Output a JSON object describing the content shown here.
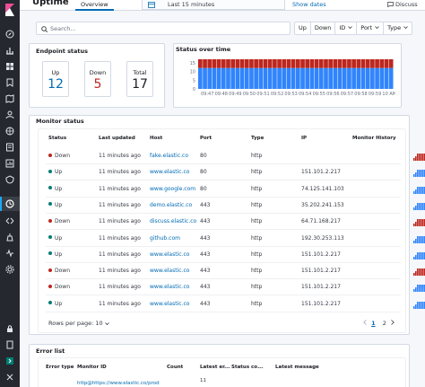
{
  "header": {
    "title": "Uptime",
    "tab": "Overview",
    "date_range": "Last 15 minutes",
    "show_dates": "Show dates",
    "discuss": "Discuss"
  },
  "search": {
    "placeholder": "Search..."
  },
  "filters": [
    "Up",
    "Down",
    "ID",
    "Port",
    "Type"
  ],
  "endpoint_status": {
    "title": "Endpoint status",
    "up_label": "Up",
    "up": "12",
    "down_label": "Down",
    "down": "5",
    "total_label": "Total",
    "total": "17"
  },
  "status_over_time": {
    "title": "Status over time",
    "y_ticks": [
      "15",
      "10",
      "5",
      "0"
    ],
    "x_ticks": [
      "09:47",
      "09:48",
      "09:49",
      "09:50",
      "09:51",
      "09:52",
      "09:53",
      "09:54",
      "09:55",
      "09:56",
      "09:57",
      "09:58",
      "09:59",
      "10 AM"
    ]
  },
  "chart_data": {
    "type": "bar",
    "title": "Status over time",
    "ylim": [
      0,
      17
    ],
    "y_ticks": [
      15,
      10,
      5,
      0
    ],
    "x_ticks": [
      "09:47",
      "09:48",
      "09:49",
      "09:50",
      "09:51",
      "09:52",
      "09:53",
      "09:54",
      "09:55",
      "09:56",
      "09:57",
      "09:58",
      "09:59",
      "10 AM"
    ],
    "stacked": true,
    "series": [
      {
        "values": [
          12,
          12,
          12,
          12,
          12,
          12,
          12,
          12,
          12,
          12,
          12,
          12,
          12,
          12,
          12,
          12,
          12,
          12,
          12,
          12,
          12,
          12,
          12,
          12,
          12,
          12,
          12,
          12,
          12,
          12,
          12,
          12,
          12,
          12,
          12,
          12,
          12,
          12,
          12,
          12,
          12,
          12
        ]
      },
      {
        "values": [
          5,
          5,
          5,
          5,
          5,
          5,
          5,
          5,
          5,
          5,
          5,
          5,
          5,
          5,
          5,
          5,
          5,
          5,
          5,
          5,
          5,
          5,
          5,
          5,
          5,
          5,
          5,
          5,
          5,
          5,
          5,
          5,
          5,
          5,
          5,
          5,
          5,
          5,
          5,
          5,
          5,
          5
        ]
      }
    ],
    "colors": {
      "up": "#3185fc",
      "down": "#bd271e"
    }
  },
  "monitor_status": {
    "title": "Monitor status",
    "columns": [
      "Status",
      "Last updated",
      "Host",
      "Port",
      "Type",
      "IP",
      "Monitor History"
    ],
    "rows": [
      {
        "status": "Down",
        "updated": "11 minutes ago",
        "host": "fake.elastic.co",
        "port": "80",
        "type": "http",
        "ip": "",
        "history": "down"
      },
      {
        "status": "Up",
        "updated": "11 minutes ago",
        "host": "www.elastic.co",
        "port": "80",
        "type": "http",
        "ip": "151.101.2.217",
        "history": "up"
      },
      {
        "status": "Up",
        "updated": "11 minutes ago",
        "host": "www.google.com",
        "port": "80",
        "type": "http",
        "ip": "74.125.141.103",
        "history": "up"
      },
      {
        "status": "Up",
        "updated": "11 minutes ago",
        "host": "demo.elastic.co",
        "port": "443",
        "type": "http",
        "ip": "35.202.241.153",
        "history": "up"
      },
      {
        "status": "Down",
        "updated": "11 minutes ago",
        "host": "discuss.elastic.co",
        "port": "443",
        "type": "http",
        "ip": "64.71.168.217",
        "history": "down"
      },
      {
        "status": "Up",
        "updated": "11 minutes ago",
        "host": "github.com",
        "port": "443",
        "type": "http",
        "ip": "192.30.253.113",
        "history": "up"
      },
      {
        "status": "Up",
        "updated": "11 minutes ago",
        "host": "www.elastic.co",
        "port": "443",
        "type": "http",
        "ip": "151.101.2.217",
        "history": "up"
      },
      {
        "status": "Down",
        "updated": "11 minutes ago",
        "host": "www.elastic.co",
        "port": "443",
        "type": "http",
        "ip": "151.101.2.217",
        "history": "down"
      },
      {
        "status": "Down",
        "updated": "11 minutes ago",
        "host": "www.elastic.co",
        "port": "443",
        "type": "http",
        "ip": "151.101.2.217",
        "history": "mixed"
      },
      {
        "status": "Up",
        "updated": "11 minutes ago",
        "host": "www.elastic.co",
        "port": "443",
        "type": "http",
        "ip": "151.101.2.217",
        "history": "up"
      }
    ],
    "rows_per_page": "Rows per page: 10",
    "pages": [
      "1",
      "2"
    ]
  },
  "error_list": {
    "title": "Error list",
    "columns": [
      "Error type",
      "Monitor ID",
      "Count",
      "Latest er...",
      "Status co...",
      "Latest message"
    ],
    "first_row": {
      "monitor_id": "http@https://www.elastic.co/prod",
      "latest": "11"
    }
  },
  "colors": {
    "up": "#017d73",
    "down": "#bd271e",
    "up_bar": "#3185fc",
    "down_bar": "#bd271e",
    "link": "#006bb4",
    "accent": "#1ba9f5"
  },
  "icons": [
    "kibana-logo",
    "discover-icon",
    "visualize-icon",
    "dashboard-icon",
    "canvas-icon",
    "maps-icon",
    "ml-icon",
    "infra-icon",
    "logs-icon",
    "apm-icon",
    "uptime-icon",
    "devtools-icon",
    "monitoring-icon",
    "management-icon",
    "collapse-icon"
  ]
}
